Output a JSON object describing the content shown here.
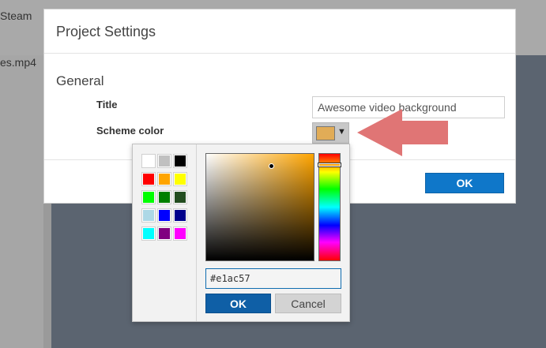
{
  "background": {
    "top_text": "Steam",
    "file_text": "es.mp4"
  },
  "dialog": {
    "title": "Project Settings",
    "section": "General",
    "title_label": "Title",
    "title_value": "Awesome video background",
    "scheme_label": "Scheme color",
    "scheme_color": "#e1ac57",
    "caret": "▼",
    "ok_label": "OK"
  },
  "picker": {
    "palette": [
      "#ffffff",
      "#c0c0c0",
      "#000000",
      "#ff0000",
      "#ffa500",
      "#ffff00",
      "#00ff00",
      "#008000",
      "#234d20",
      "#add8e6",
      "#0000ff",
      "#00008b",
      "#00ffff",
      "#800080",
      "#ff00ff"
    ],
    "hue_color": "#ffa500",
    "saturation": 0.61,
    "value": 0.88,
    "hue_level": 0.1,
    "hex_value": "#e1ac57",
    "ok_label": "OK",
    "cancel_label": "Cancel"
  },
  "annotation": {
    "arrow_color": "#e07575"
  }
}
